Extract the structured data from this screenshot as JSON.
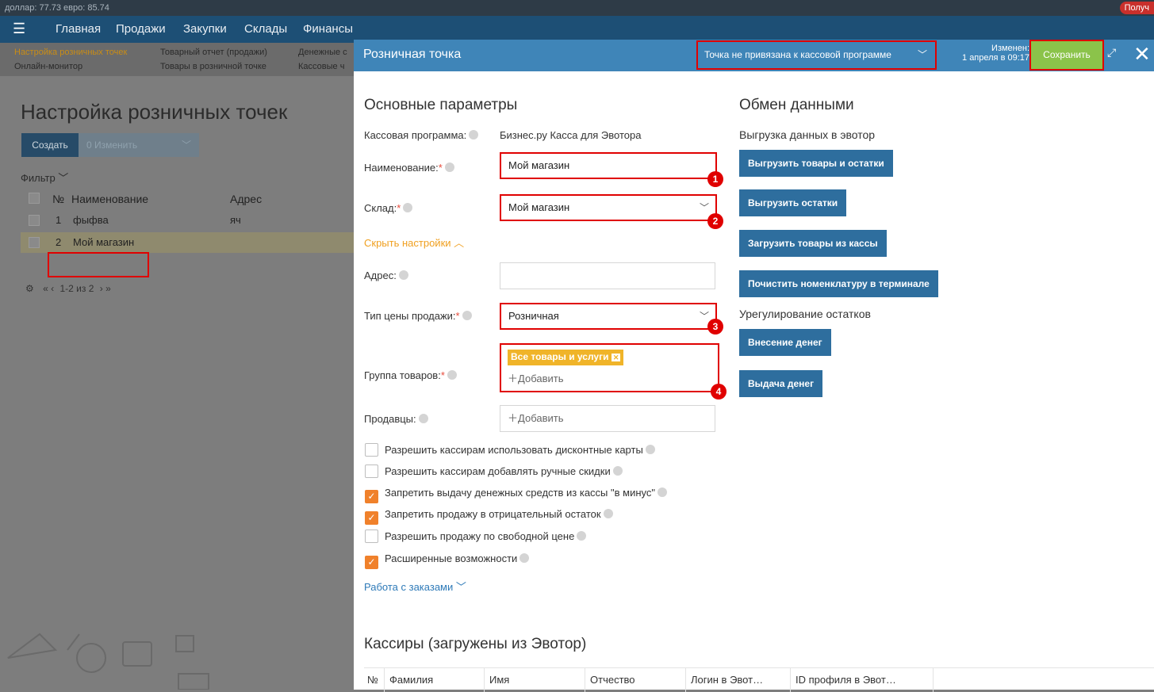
{
  "currency_bar": {
    "text": "доллар: 77.73   евро: 85.74",
    "badge": "Получ"
  },
  "bg": {
    "nav": [
      "Главная",
      "Продажи",
      "Закупки",
      "Склады",
      "Финансы"
    ],
    "subnav": [
      "Настройка розничных точек",
      "Товарный отчет (продажи)",
      "Денежные с",
      "Онлайн-монитор",
      "Товары в розничной точке",
      "Кассовые ч"
    ],
    "page_title": "Настройка розничных точек",
    "create_label": "Создать",
    "edit_label": "0  Изменить",
    "filter_label": "Фильтр",
    "col_no": "№",
    "col_name": "Наименование",
    "col_address": "Адрес",
    "rows": [
      {
        "no": "1",
        "name": "фыфва",
        "address": "яч"
      },
      {
        "no": "2",
        "name": "Мой магазин",
        "address": ""
      }
    ],
    "pager": "1-2 из 2"
  },
  "modal": {
    "title": "Розничная точка",
    "kassa_select": "Точка не привязана к кассовой программе",
    "changed_label": "Изменен:",
    "changed_date": "1 апреля в 09:17",
    "save_label": "Сохранить",
    "basic_header": "Основные параметры",
    "kassa_prog_label": "Кассовая программа:",
    "kassa_prog_value": "Бизнес.ру Касса для Эвотора",
    "name_label": "Наименование:",
    "name_value": "Мой магазин",
    "sklad_label": "Склад:",
    "sklad_value": "Мой магазин",
    "hide_settings": "Скрыть настройки",
    "address_label": "Адрес:",
    "address_value": "",
    "price_type_label": "Тип цены продажи:",
    "price_type_value": "Розничная",
    "group_label": "Группа товаров:",
    "group_tag": "Все товары и услуги",
    "add_label": "Добавить",
    "sellers_label": "Продавцы:",
    "checkboxes": [
      {
        "label": "Разрешить кассирам использовать дисконтные карты",
        "checked": false
      },
      {
        "label": "Разрешить кассирам добавлять ручные скидки",
        "checked": false
      },
      {
        "label": "Запретить выдачу денежных средств из кассы \"в минус\"",
        "checked": true
      },
      {
        "label": "Запретить продажу в отрицательный остаток",
        "checked": true
      },
      {
        "label": "Разрешить продажу по свободной цене",
        "checked": false
      },
      {
        "label": "Расширенные возможности",
        "checked": true
      }
    ],
    "orders_link": "Работа с заказами",
    "exchange_header": "Обмен данными",
    "export_label": "Выгрузка данных в эвотор",
    "btn_export_goods": "Выгрузить товары и остатки",
    "btn_export_stock": "Выгрузить остатки",
    "btn_import_goods": "Загрузить товары из кассы",
    "btn_clean": "Почистить номенклатуру в терминале",
    "regulation_label": "Урегулирование остатков",
    "btn_deposit": "Внесение денег",
    "btn_withdraw": "Выдача денег",
    "cashiers_header": "Кассиры (загружены из Эвотор)",
    "cashier_cols": [
      "№",
      "Фамилия",
      "Имя",
      "Отчество",
      "Логин в Эвот…",
      "ID профиля в Эвот…"
    ],
    "markers": [
      "1",
      "2",
      "3",
      "4"
    ]
  }
}
